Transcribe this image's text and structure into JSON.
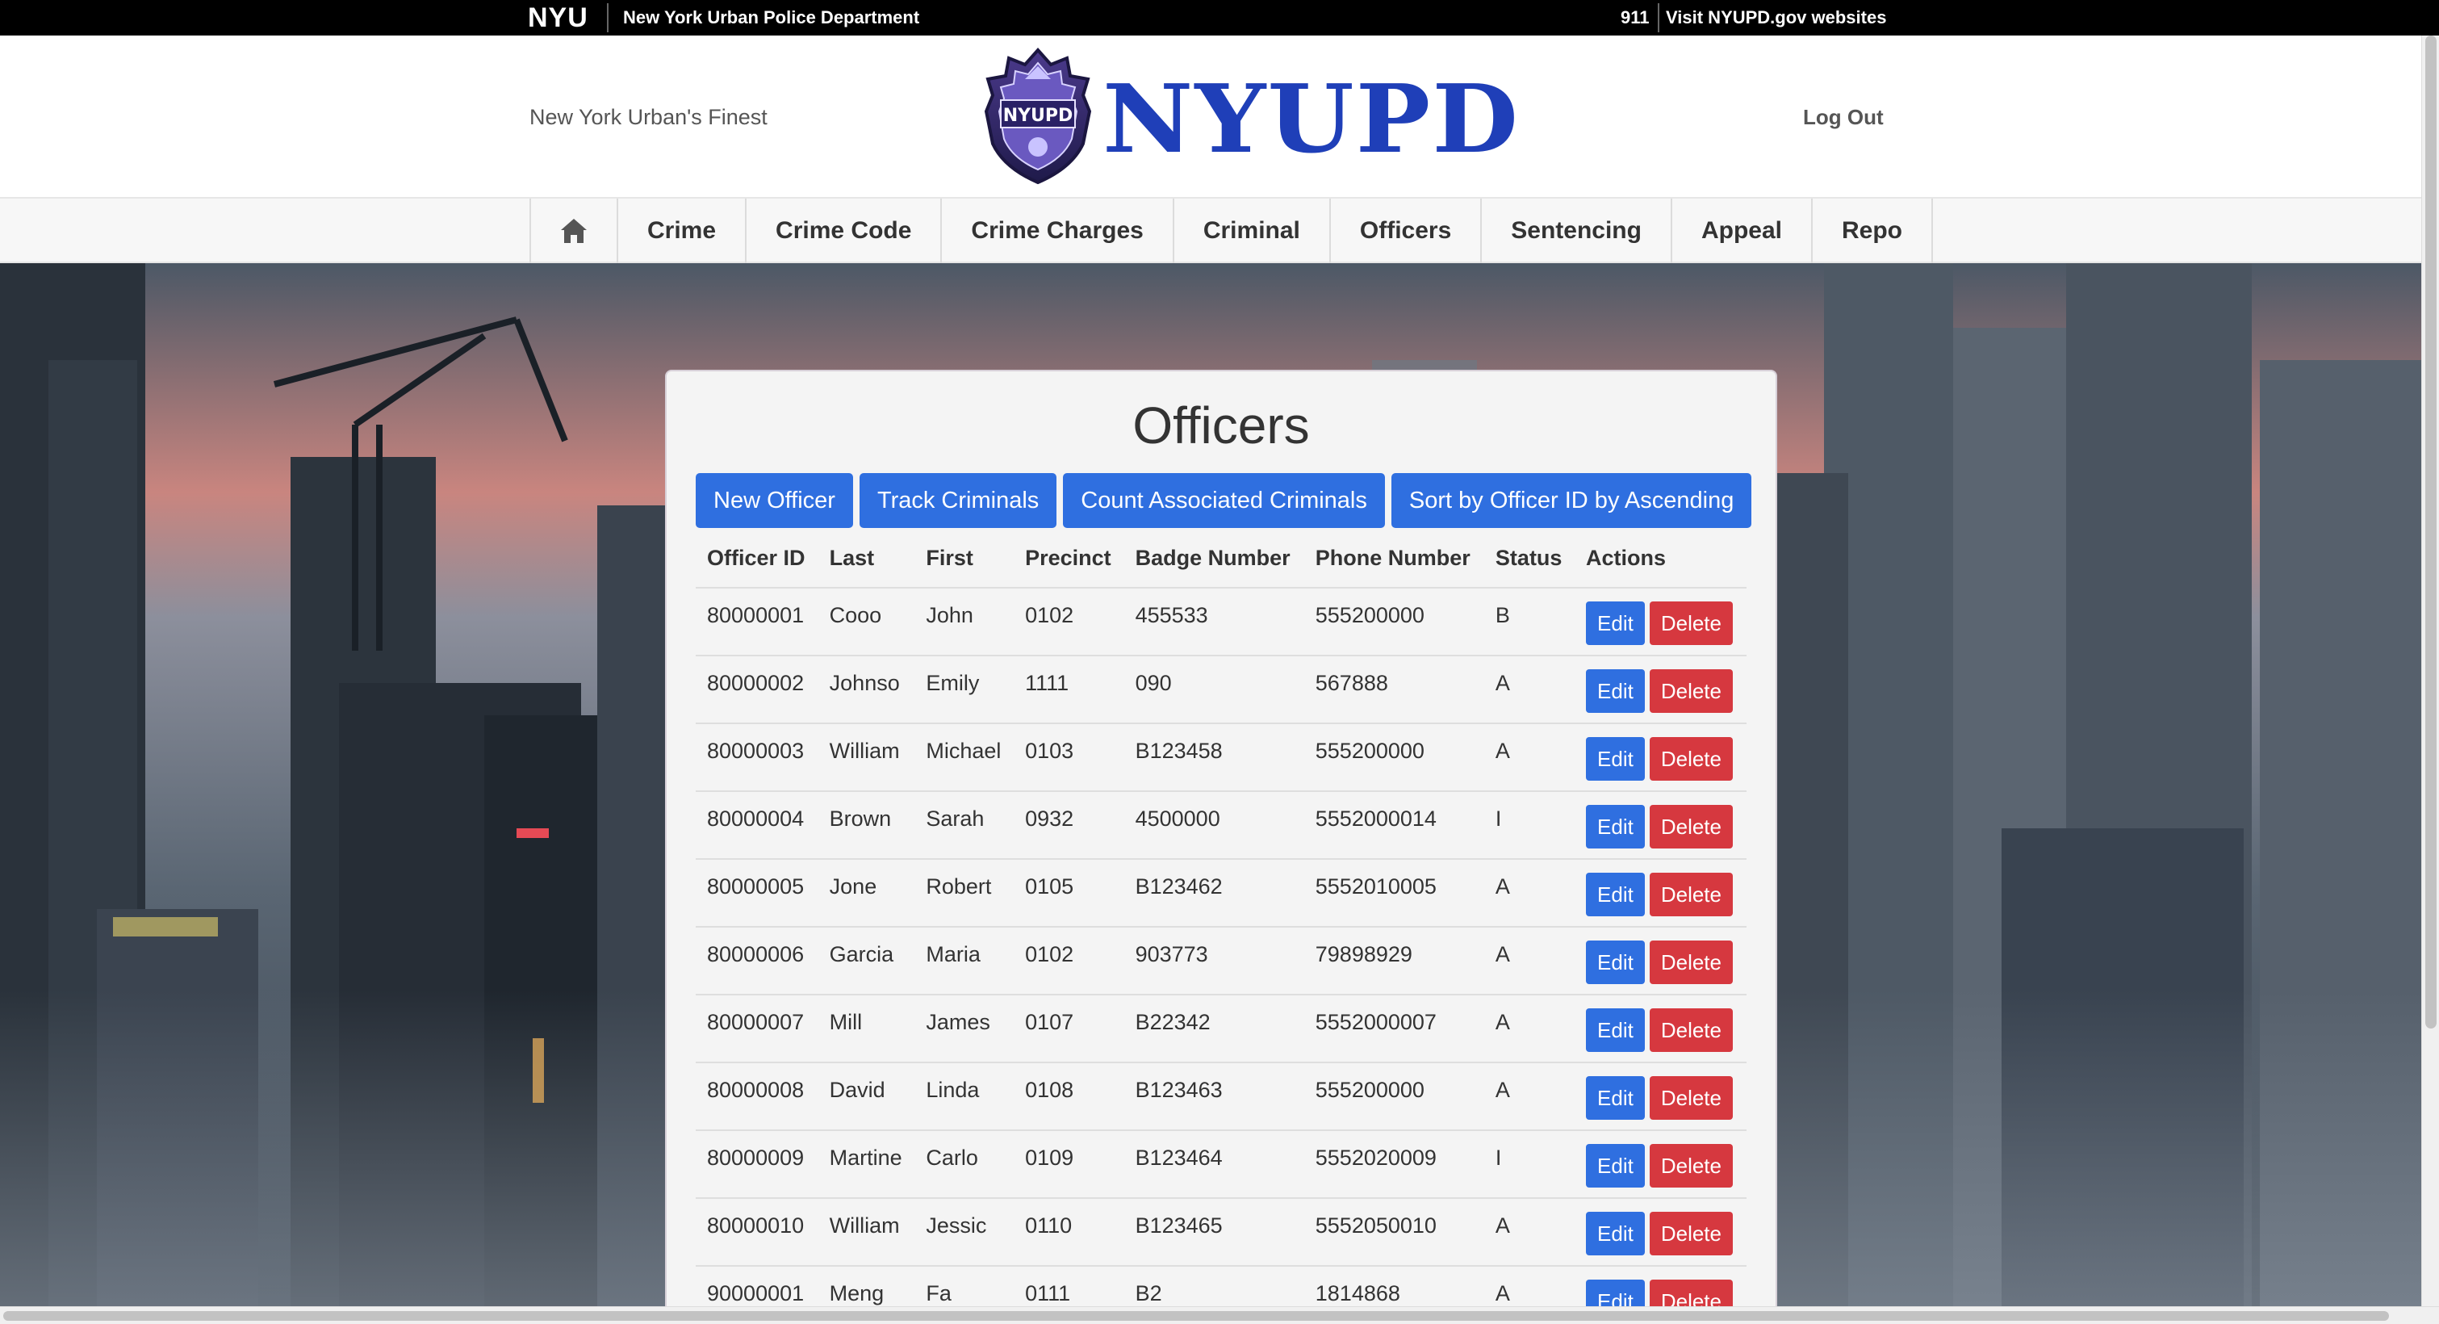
{
  "topbar": {
    "brand": "NYU",
    "department": "New York Urban Police Department",
    "emergency": "911",
    "visit": "Visit NYUPD.gov websites"
  },
  "header": {
    "tagline": "New York Urban's Finest",
    "logo_text": "NYUPD",
    "badge_text": "NYUPD",
    "logout": "Log Out"
  },
  "nav": {
    "home_icon": "home-icon",
    "items": [
      "Crime",
      "Crime Code",
      "Crime Charges",
      "Criminal",
      "Officers",
      "Sentencing",
      "Appeal",
      "Repo"
    ]
  },
  "page": {
    "title": "Officers",
    "buttons": [
      "New Officer",
      "Track Criminals",
      "Count Associated Criminals",
      "Sort by Officer ID by Ascending"
    ]
  },
  "table": {
    "headers": [
      "Officer ID",
      "Last",
      "First",
      "Precinct",
      "Badge Number",
      "Phone Number",
      "Status",
      "Actions"
    ],
    "rows": [
      [
        "80000001",
        "Cooo",
        "John",
        "0102",
        "455533",
        "555200000",
        "B"
      ],
      [
        "80000002",
        "Johnso",
        "Emily",
        "1111",
        "090",
        "567888",
        "A"
      ],
      [
        "80000003",
        "William",
        "Michael",
        "0103",
        "B123458",
        "555200000",
        "A"
      ],
      [
        "80000004",
        "Brown",
        "Sarah",
        "0932",
        "4500000",
        "5552000014",
        "I"
      ],
      [
        "80000005",
        "Jone",
        "Robert",
        "0105",
        "B123462",
        "5552010005",
        "A"
      ],
      [
        "80000006",
        "Garcia",
        "Maria",
        "0102",
        "903773",
        "79898929",
        "A"
      ],
      [
        "80000007",
        "Mill",
        "James",
        "0107",
        "B22342",
        "5552000007",
        "A"
      ],
      [
        "80000008",
        "David",
        "Linda",
        "0108",
        "B123463",
        "555200000",
        "A"
      ],
      [
        "80000009",
        "Martine",
        "Carlo",
        "0109",
        "B123464",
        "5552020009",
        "I"
      ],
      [
        "80000010",
        "William",
        "Jessic",
        "0110",
        "B123465",
        "5552050010",
        "A"
      ],
      [
        "90000001",
        "Meng",
        "Fa",
        "0111",
        "B2",
        "1814868",
        "A"
      ]
    ],
    "edit_label": "Edit",
    "delete_label": "Delete"
  },
  "colors": {
    "primary": "#2f6fe0",
    "danger": "#d6383f",
    "brand_blue": "#1f3fb8"
  }
}
